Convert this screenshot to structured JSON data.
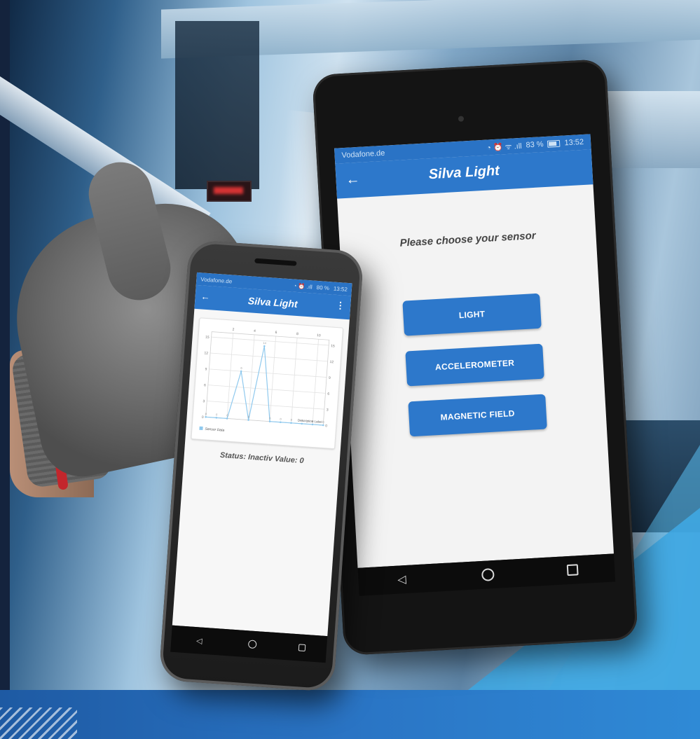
{
  "tablet": {
    "status": {
      "carrier": "Vodafone.de",
      "signal": "83 %",
      "time": "13:52"
    },
    "app_title": "Silva Light",
    "prompt": "Please choose your sensor",
    "sensors": [
      "LIGHT",
      "ACCELEROMETER",
      "MAGNETIC FIELD"
    ]
  },
  "phone": {
    "status": {
      "carrier": "Vodafone.de",
      "signal": "80 %",
      "time": "13:52"
    },
    "app_title": "Silva Light",
    "status_line": "Status: Inactiv Value: 0",
    "legend": "Sensor Data",
    "description": "Description Label"
  },
  "chart_data": {
    "type": "line",
    "x_ticks": [
      2,
      4,
      6,
      8,
      10
    ],
    "y_ticks": [
      0,
      3,
      6,
      9,
      12,
      15
    ],
    "xlim": [
      0,
      11
    ],
    "ylim": [
      0,
      16
    ],
    "x": [
      0,
      1,
      2,
      3,
      4,
      5,
      6,
      7,
      8,
      9,
      10,
      11
    ],
    "values": [
      0,
      0,
      0,
      9,
      0,
      14,
      0,
      0,
      0,
      0,
      0,
      0
    ],
    "series_name": "Sensor Data",
    "color": "#8fc9ee"
  },
  "colors": {
    "accent": "#2d78cb",
    "status_bar": "#2a73c5"
  }
}
